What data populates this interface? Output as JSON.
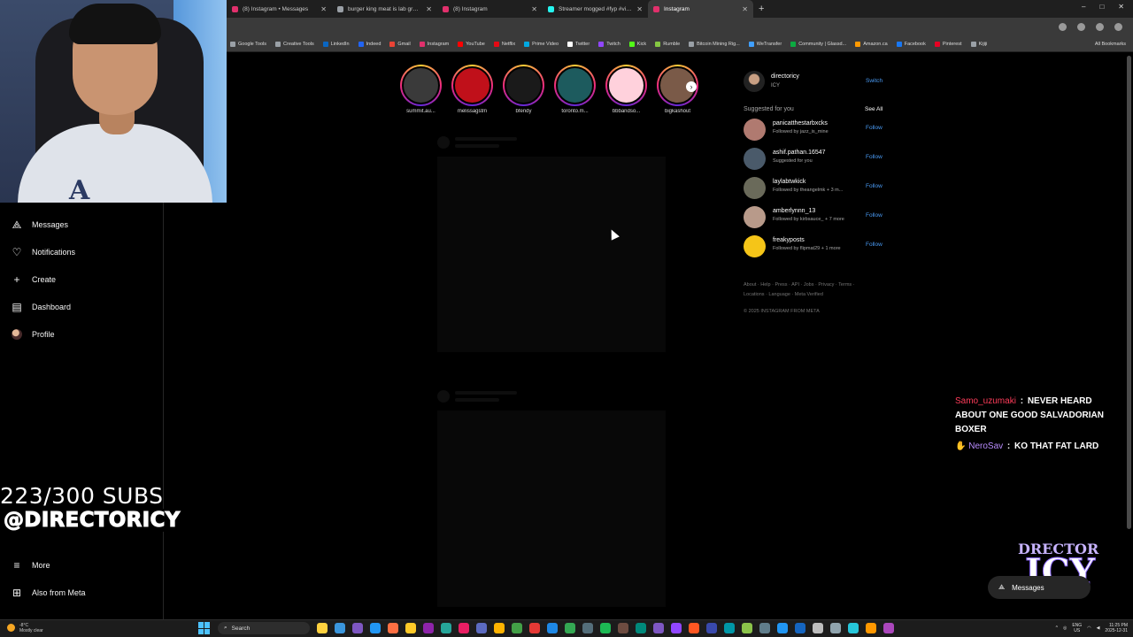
{
  "browser": {
    "tabs": [
      {
        "title": "(8) Instagram • Messages",
        "color": "#e1306c",
        "active": false
      },
      {
        "title": "burger king meat is lab grown",
        "color": "#9aa0a6",
        "active": false
      },
      {
        "title": "(8) Instagram",
        "color": "#e1306c",
        "active": false
      },
      {
        "title": "Streamer mogged #fyp #viral",
        "color": "#25f4ee",
        "active": false
      },
      {
        "title": "Instagram",
        "color": "#e1306c",
        "active": true
      }
    ],
    "new_tab": "+",
    "window_controls": [
      "–",
      "□",
      "✕"
    ],
    "bookmarks": [
      {
        "label": "Google Tools",
        "color": "#9aa0a6"
      },
      {
        "label": "Creative Tools",
        "color": "#9aa0a6"
      },
      {
        "label": "LinkedIn",
        "color": "#0a66c2"
      },
      {
        "label": "Indeed",
        "color": "#2164f3"
      },
      {
        "label": "Gmail",
        "color": "#ea4335"
      },
      {
        "label": "Instagram",
        "color": "#e1306c"
      },
      {
        "label": "YouTube",
        "color": "#ff0000"
      },
      {
        "label": "Netflix",
        "color": "#e50914"
      },
      {
        "label": "Prime Video",
        "color": "#00a8e1"
      },
      {
        "label": "Twitter",
        "color": "#ffffff"
      },
      {
        "label": "Twitch",
        "color": "#9146ff"
      },
      {
        "label": "Kick",
        "color": "#53fc18"
      },
      {
        "label": "Rumble",
        "color": "#85c742"
      },
      {
        "label": "Bitcoin Mining Rig...",
        "color": "#9aa0a6"
      },
      {
        "label": "WeTransfer",
        "color": "#409fff"
      },
      {
        "label": "Community | Glassd...",
        "color": "#0caa41"
      },
      {
        "label": "Amazon.ca",
        "color": "#ff9900"
      },
      {
        "label": "Facebook",
        "color": "#1877f2"
      },
      {
        "label": "Pinterest",
        "color": "#e60023"
      },
      {
        "label": "Kijiji",
        "color": "#9aa0a6"
      }
    ],
    "all_bookmarks": "All Bookmarks"
  },
  "sidebar": {
    "items": [
      {
        "label": "Messages",
        "icon": "messenger-icon",
        "glyph": "⟁"
      },
      {
        "label": "Notifications",
        "icon": "heart-icon",
        "glyph": "♡"
      },
      {
        "label": "Create",
        "icon": "plus-icon",
        "glyph": "+"
      },
      {
        "label": "Dashboard",
        "icon": "dashboard-icon",
        "glyph": "▤"
      },
      {
        "label": "Profile",
        "icon": "avatar-icon",
        "glyph": ""
      }
    ],
    "more": "More",
    "also_from_meta": "Also from Meta"
  },
  "overlay": {
    "subs_count": "223/300 SUBS",
    "handle": "@DIRECTORICY"
  },
  "stories": [
    {
      "name": "summit.au...",
      "color": "#3a3a3a"
    },
    {
      "name": "melissagstm",
      "color": "#c0101a"
    },
    {
      "name": "bfendy",
      "color": "#1a1a1a"
    },
    {
      "name": "toronto.m...",
      "color": "#1d5b5e"
    },
    {
      "name": "bbbandso...",
      "color": "#ffd1dc"
    },
    {
      "name": "bigkashout",
      "color": "#7a5a48"
    }
  ],
  "account": {
    "username": "directoricy",
    "subtitle": "ICY",
    "switch_label": "Switch"
  },
  "suggestions": {
    "header": "Suggested for you",
    "see_all": "See All",
    "follow_label": "Follow",
    "items": [
      {
        "name": "panicatthestarbxcks",
        "sub": "Followed by jazz_is_mine",
        "color": "#b07a70"
      },
      {
        "name": "ashif.pathan.16547",
        "sub": "Suggested for you",
        "color": "#4a5a6a"
      },
      {
        "name": "laylabtwkick",
        "sub": "Followed by theangelmk + 3 m...",
        "color": "#6a6a5a"
      },
      {
        "name": "amberlynnn_13",
        "sub": "Followed by kirbsauce_ + 7 more",
        "color": "#b89a8a"
      },
      {
        "name": "freakyposts",
        "sub": "Followed by flipmat29 + 1 more",
        "color": "#f5c518"
      }
    ]
  },
  "footer": {
    "links": "About · Help · Press · API · Jobs · Privacy · Terms · Locations · Language · Meta Verified",
    "copyright": "© 2025 INSTAGRAM FROM META"
  },
  "chat": {
    "user1": "Samo_uzumaki",
    "msg1": "NEVER HEARD ABOUT ONE GOOD SALVADORIAN BOXER",
    "user2": "NeroSav",
    "msg2": "KO THAT FAT LARD",
    "separator": ":"
  },
  "logo": {
    "top": "DRECTOR",
    "big": "ICY"
  },
  "messages_pill": "Messages",
  "taskbar": {
    "weather_temp": "-8°C",
    "weather_desc": "Mostly clear",
    "search": "Search",
    "lang": "ENG",
    "region": "US",
    "time": "11:25 PM",
    "date": "2025-12-31",
    "apps": [
      "#ffd23f",
      "#3a96dd",
      "#7e57c2",
      "#2196f3",
      "#ff7043",
      "#ffca28",
      "#8e24aa",
      "#26a69a",
      "#e91e63",
      "#5c6bc0",
      "#ffb300",
      "#43a047",
      "#e53935",
      "#1e88e5",
      "#34a853",
      "#546e7a",
      "#1db954",
      "#6d4c41",
      "#00897b",
      "#7e57c2",
      "#9146ff",
      "#ff5722",
      "#3949ab",
      "#0097a7",
      "#8bc34a",
      "#607d8b",
      "#2196f3",
      "#1565c0",
      "#bdbdbd",
      "#90a4ae",
      "#26c6da",
      "#ff9800",
      "#ab47bc"
    ]
  }
}
